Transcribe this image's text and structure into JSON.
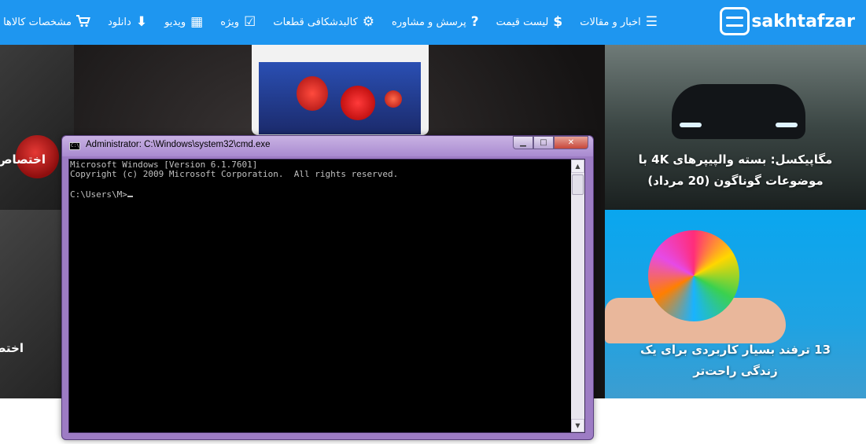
{
  "site": {
    "logo_text": "sakhtafzar",
    "nav": [
      {
        "label": "اخبار و مقالات",
        "icon": "newspaper-icon",
        "glyph": "☰"
      },
      {
        "label": "لیست قیمت",
        "icon": "dollar-icon",
        "glyph": "$"
      },
      {
        "label": "پرسش و مشاوره",
        "icon": "question-icon",
        "glyph": "?"
      },
      {
        "label": "کالبدشکافی قطعات",
        "icon": "gears-icon",
        "glyph": "⚙"
      },
      {
        "label": "ویژه",
        "icon": "check-square-icon",
        "glyph": "☑"
      },
      {
        "label": "ویدیو",
        "icon": "film-icon",
        "glyph": "▦"
      },
      {
        "label": "دانلود",
        "icon": "download-icon",
        "glyph": "⬇"
      },
      {
        "label": "مشخصات کالاها",
        "icon": "cart-icon",
        "glyph": "🛒"
      }
    ],
    "tiles": {
      "car_title": "مگاپیکسل: بسته والپیپرهای 4K با موضوعات گوناگون (20 مرداد)",
      "ball_title": "13 ترفند بسیار کاربردی برای یک زندگی راحت‌تر",
      "left_top_title": "اختصاص",
      "left_bottom_title": "اختص"
    },
    "colors": {
      "nav_bg": "#1e96f0"
    }
  },
  "cmd": {
    "title": "Administrator: C:\\Windows\\system32\\cmd.exe",
    "buttons": {
      "minimize": "▁",
      "maximize": "□",
      "close": "✕"
    },
    "lines": [
      "Microsoft Windows [Version 6.1.7601]",
      "Copyright (c) 2009 Microsoft Corporation.  All rights reserved.",
      "",
      "C:\\Users\\M>"
    ]
  }
}
